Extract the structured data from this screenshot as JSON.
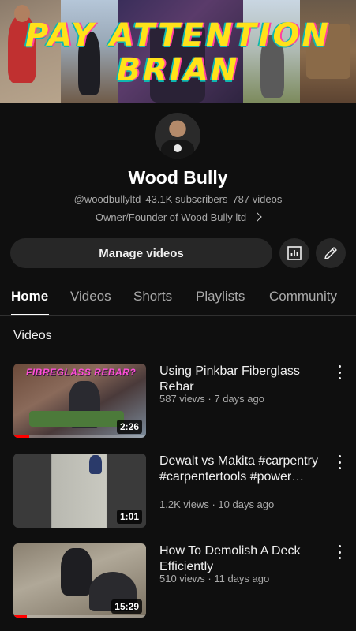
{
  "banner": {
    "line1": "PAY ATTENTION",
    "line2": "BRIAN"
  },
  "channel": {
    "name": "Wood Bully",
    "handle": "@woodbullyltd",
    "subscribers": "43.1K subscribers",
    "videos": "787 videos",
    "description": "Owner/Founder of Wood Bully ltd"
  },
  "actions": {
    "manage_label": "Manage videos"
  },
  "tabs": [
    {
      "label": "Home",
      "active": true
    },
    {
      "label": "Videos",
      "active": false
    },
    {
      "label": "Shorts",
      "active": false
    },
    {
      "label": "Playlists",
      "active": false
    },
    {
      "label": "Community",
      "active": false
    }
  ],
  "section": {
    "title": "Videos"
  },
  "videos": [
    {
      "title": "Using Pinkbar Fiberglass Rebar",
      "meta": "587 views · 7 days ago",
      "duration": "2:26",
      "thumb_text": "FIBREGLASS REBAR?",
      "watched_fraction": 0.12
    },
    {
      "title": "Dewalt vs Makita #carpentry #carpentertools #power…",
      "meta": "1.2K views · 10 days ago",
      "duration": "1:01",
      "thumb_text": "",
      "watched_fraction": 0
    },
    {
      "title": "How To Demolish A Deck Efficiently",
      "meta": "510 views · 11 days ago",
      "duration": "15:29",
      "thumb_text": "",
      "watched_fraction": 0.1
    }
  ],
  "colors": {
    "background": "#0f0f0f",
    "button": "#272727",
    "accent_progress": "#ff0000",
    "banner_text": "#ffe21a"
  }
}
